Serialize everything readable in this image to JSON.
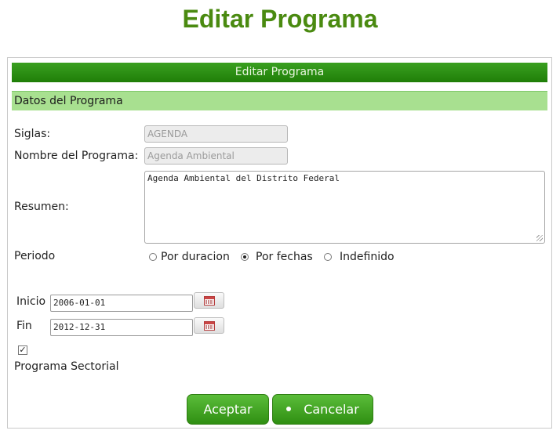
{
  "page": {
    "title": "Editar Programa"
  },
  "panel": {
    "header": "Editar Programa",
    "section": "Datos del Programa"
  },
  "form": {
    "siglas_label": "Siglas:",
    "siglas_value": "AGENDA",
    "nombre_label": "Nombre del Programa:",
    "nombre_value": "Agenda Ambiental",
    "resumen_label": "Resumen:",
    "resumen_value": "Agenda Ambiental del Distrito Federal",
    "periodo_label": "Periodo",
    "periodo_options": [
      {
        "label": "Por duracion",
        "checked": false
      },
      {
        "label": "Por fechas",
        "checked": true
      },
      {
        "label": "Indefinido",
        "checked": false
      }
    ],
    "inicio_label": "Inicio",
    "inicio_value": "2006-01-01",
    "fin_label": "Fin",
    "fin_value": "2012-12-31",
    "sectorial_checked": true,
    "sectorial_label": "Programa Sectorial"
  },
  "buttons": {
    "accept": "Aceptar",
    "cancel": "Cancelar"
  },
  "icons": {
    "calendar": "calendar-icon",
    "check": "checkmark-icon"
  },
  "colors": {
    "title": "#4a8a10",
    "header_bg": "#1f7e08",
    "section_bg": "#a8e090",
    "button_bg": "#2f8f12"
  }
}
